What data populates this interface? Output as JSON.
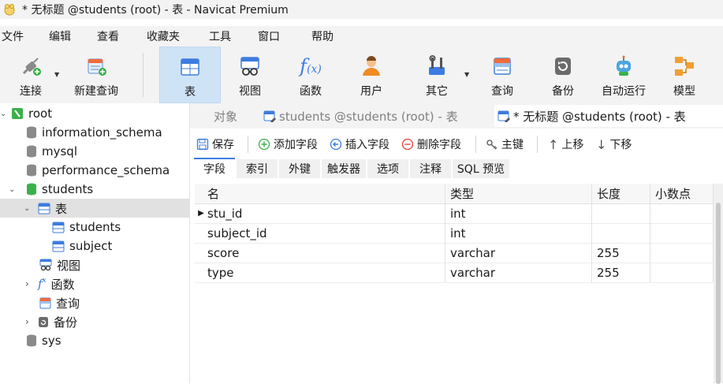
{
  "titlebar": {
    "title": "* 无标题 @students (root) - 表 - Navicat Premium"
  },
  "menu": [
    "文件",
    "编辑",
    "查看",
    "收藏夹",
    "工具",
    "窗口",
    "帮助"
  ],
  "toolbar": {
    "connect": "连接",
    "new_query": "新建查询",
    "table": "表",
    "view": "视图",
    "function": "函数",
    "user": "用户",
    "other": "其它",
    "query": "查询",
    "backup": "备份",
    "automation": "自动运行",
    "model": "模型"
  },
  "tree": {
    "root": "root",
    "dbs": [
      "information_schema",
      "mysql",
      "performance_schema",
      "students"
    ],
    "tables_label": "表",
    "tables": [
      "students",
      "subject"
    ],
    "views_label": "视图",
    "functions_label": "函数",
    "queries_label": "查询",
    "backups_label": "备份",
    "sys": "sys"
  },
  "tabs": {
    "objects": "对象",
    "tab1": "students @students (root) - 表",
    "tab2": "* 无标题 @students (root) - 表"
  },
  "actions": {
    "save": "保存",
    "add_field": "添加字段",
    "insert_field": "插入字段",
    "delete_field": "删除字段",
    "primary_key": "主键",
    "move_up": "上移",
    "move_down": "下移"
  },
  "subtabs": [
    "字段",
    "索引",
    "外键",
    "触发器",
    "选项",
    "注释",
    "SQL 预览"
  ],
  "grid": {
    "headers": [
      "名",
      "类型",
      "长度",
      "小数点"
    ],
    "rows": [
      {
        "name": "stu_id",
        "type": "int",
        "length": "",
        "decimals": ""
      },
      {
        "name": "subject_id",
        "type": "int",
        "length": "",
        "decimals": ""
      },
      {
        "name": "score",
        "type": "varchar",
        "length": "255",
        "decimals": ""
      },
      {
        "name": "type",
        "type": "varchar",
        "length": "255",
        "decimals": ""
      }
    ]
  },
  "colors": {
    "accent": "#3c7ce0",
    "active_tool": "#cfe3f7",
    "db_green": "#3cb04a"
  }
}
